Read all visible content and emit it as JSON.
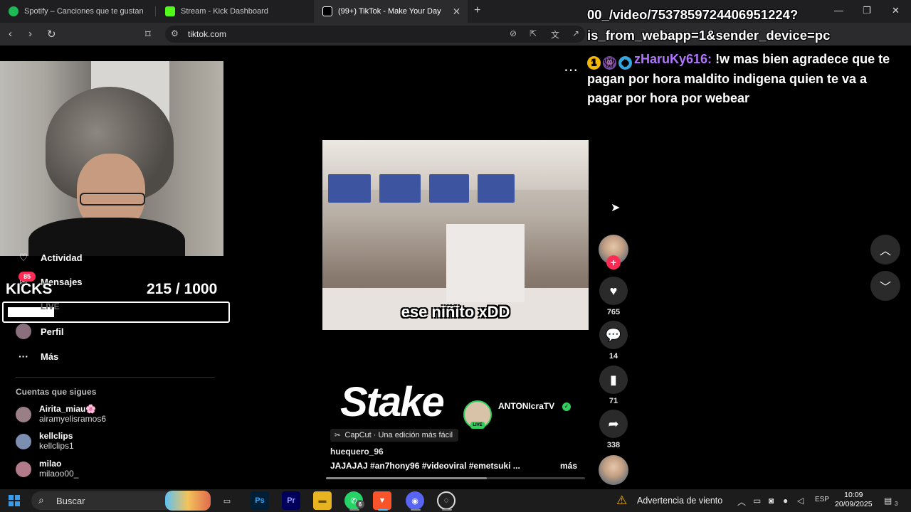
{
  "browser": {
    "tabs": [
      {
        "label": "Spotify – Canciones que te gustan",
        "color": "#1db954"
      },
      {
        "label": "Stream - Kick Dashboard",
        "color": "#53fc18"
      },
      {
        "label": "(99+) TikTok - Make Your Day",
        "color": "#ffffff"
      }
    ],
    "url": "tiktok.com"
  },
  "sidebar": {
    "items": [
      {
        "label": "Actividad"
      },
      {
        "label": "Mensajes",
        "badge": "85"
      },
      {
        "label": "LIVE"
      },
      {
        "label": "Perfil"
      },
      {
        "label": "Más"
      }
    ],
    "following_title": "Cuentas que sigues",
    "following": [
      {
        "name": "Airita_miau🌸",
        "user": "airamyelisramos6",
        "color": "#9a7f86"
      },
      {
        "name": "kellclips",
        "user": "kellclips1",
        "color": "#7d8fb1"
      },
      {
        "name": "milao",
        "user": "milaoo00_",
        "color": "#b17b8a"
      }
    ]
  },
  "kicks": {
    "label": "KICKS",
    "count": "215  / 1000",
    "progress": 0.215
  },
  "video": {
    "caption": "ese niñito xDD",
    "more_icon": "more-dots-icon",
    "progress": 0.62
  },
  "actions": {
    "likes": "765",
    "comments": "14",
    "saves": "71",
    "shares": "338"
  },
  "post": {
    "overlay_brand": "Stake",
    "live_label": "LIVE",
    "streamer": "ANTONIcraTV",
    "capcut": "CapCut · Una edición más fácil",
    "username": "huequero_96",
    "description": "JAJAJAJ #an7hony96 #videoviral #emetsuki ...",
    "more": "más"
  },
  "chat": {
    "url_line1": "00_/video/7537859724406951224?",
    "url_line2": "is_from_webapp=1&sender_device=pc",
    "user": "zHaruKy616:",
    "message": "!w mas bien agradece que te pagan por hora maldito indigena quien te va a pagar por hora por webear"
  },
  "taskbar": {
    "search_placeholder": "Buscar",
    "weather": "Advertencia de viento",
    "lang": "ESP",
    "time": "10:09",
    "date": "20/09/2025",
    "notifications": "3",
    "whatsapp_badge": "6"
  }
}
